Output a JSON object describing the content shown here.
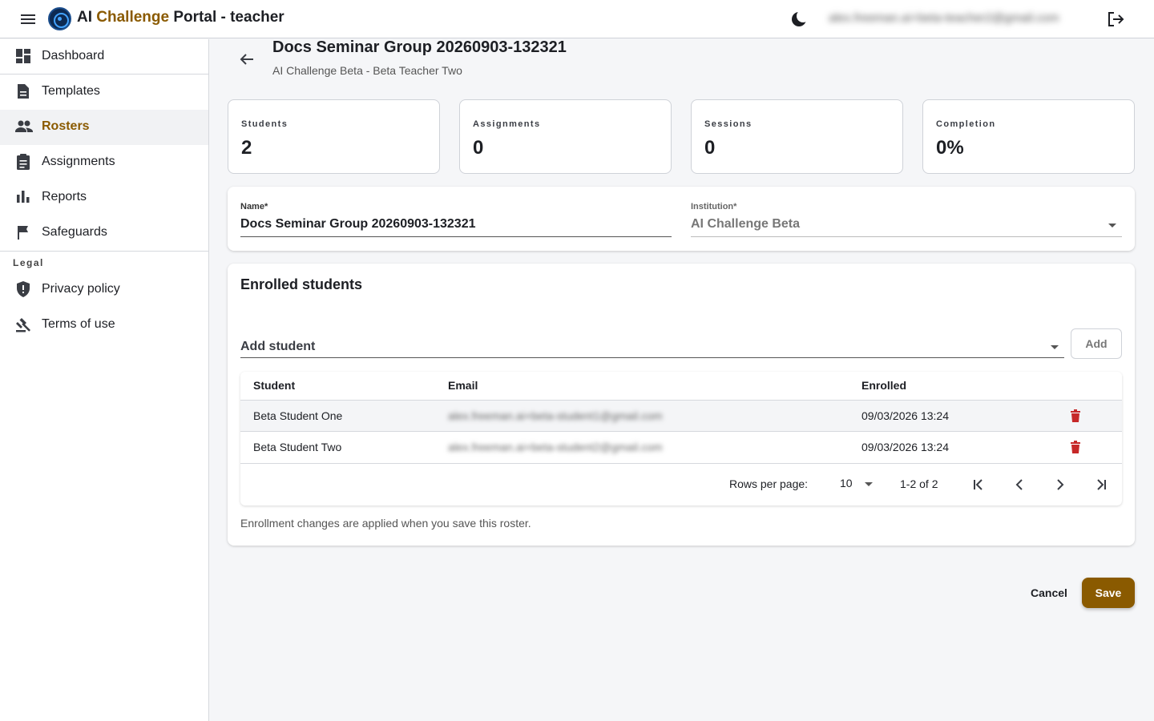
{
  "header": {
    "title_prefix": "AI",
    "title_accent": "Challenge",
    "title_suffix": "Portal - teacher",
    "user_email": "alex.freeman.ai+beta-teacher2@gmail.com"
  },
  "sidebar": {
    "items": [
      {
        "label": "Dashboard",
        "icon": "dashboard-icon"
      },
      {
        "label": "Templates",
        "icon": "document-icon"
      },
      {
        "label": "Rosters",
        "icon": "people-icon",
        "active": true
      },
      {
        "label": "Assignments",
        "icon": "clipboard-icon"
      },
      {
        "label": "Reports",
        "icon": "bar-chart-icon"
      },
      {
        "label": "Safeguards",
        "icon": "flag-icon"
      }
    ],
    "legal_section": "Legal",
    "legal_items": [
      {
        "label": "Privacy policy",
        "icon": "shield-icon"
      },
      {
        "label": "Terms of use",
        "icon": "gavel-icon"
      }
    ]
  },
  "page": {
    "title": "Docs Seminar Group 20260903-132321",
    "subtitle": "AI Challenge Beta - Beta Teacher Two"
  },
  "stats": [
    {
      "label": "Students",
      "value": "2"
    },
    {
      "label": "Assignments",
      "value": "0"
    },
    {
      "label": "Sessions",
      "value": "0"
    },
    {
      "label": "Completion",
      "value": "0%"
    }
  ],
  "form": {
    "name_label": "Name*",
    "name_value": "Docs Seminar Group 20260903-132321",
    "institution_label": "Institution*",
    "institution_value": "AI Challenge Beta"
  },
  "enrolled": {
    "heading": "Enrolled students",
    "add_placeholder": "Add student",
    "add_button": "Add",
    "columns": [
      "Student",
      "Email",
      "Enrolled"
    ],
    "rows": [
      {
        "student": "Beta Student One",
        "email": "alex.freeman.ai+beta-student1@gmail.com",
        "enrolled": "09/03/2026 13:24"
      },
      {
        "student": "Beta Student Two",
        "email": "alex.freeman.ai+beta-student2@gmail.com",
        "enrolled": "09/03/2026 13:24"
      }
    ],
    "rows_per_page_label": "Rows per page:",
    "rows_per_page": "10",
    "range": "1-2 of 2",
    "note": "Enrollment changes are applied when you save this roster."
  },
  "actions": {
    "cancel": "Cancel",
    "save": "Save"
  },
  "colors": {
    "accent": "#8a5a00",
    "danger": "#c62828"
  }
}
